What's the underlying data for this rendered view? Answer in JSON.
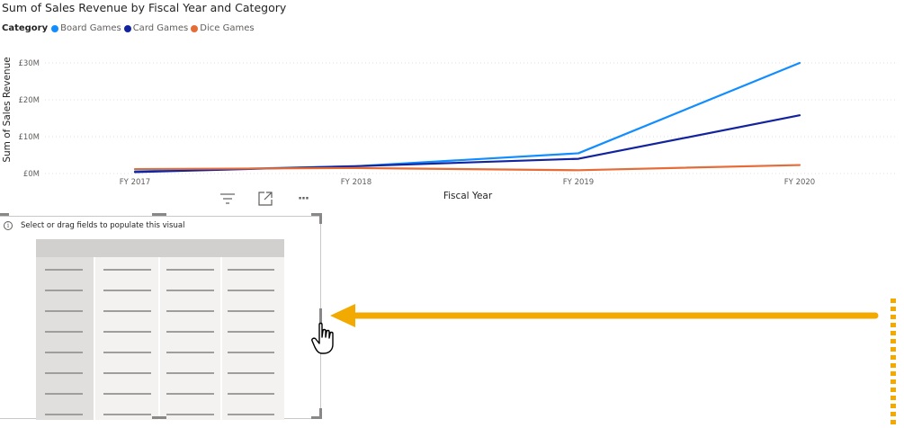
{
  "chart_data": {
    "type": "line",
    "title": "Sum of Sales Revenue by Fiscal Year and Category",
    "legend_title": "Category",
    "legend_position": "top-left",
    "xlabel": "Fiscal Year",
    "ylabel": "Sum of Sales Revenue",
    "categories": [
      "FY 2017",
      "FY 2018",
      "FY 2019",
      "FY 2020"
    ],
    "y_ticks": [
      0,
      10,
      20,
      30
    ],
    "y_tick_labels": [
      "£0M",
      "£10M",
      "£20M",
      "£30M"
    ],
    "ylim": [
      0,
      30
    ],
    "y_unit": "£M",
    "grid": "horizontal dotted",
    "series": [
      {
        "name": "Board Games",
        "color": "#118DFF",
        "values": [
          0.6,
          2.0,
          5.5,
          30.0
        ]
      },
      {
        "name": "Card Games",
        "color": "#12239E",
        "values": [
          0.4,
          2.0,
          4.0,
          15.8
        ]
      },
      {
        "name": "Dice Games",
        "color": "#E66C37",
        "values": [
          1.2,
          1.5,
          0.9,
          2.3
        ]
      }
    ]
  },
  "visual_header": {
    "icons": [
      "filter-icon",
      "focus-mode-icon",
      "more-options-icon"
    ],
    "more_label": "···"
  },
  "table_visual": {
    "info_text": "Select or drag fields to populate this visual",
    "info_icon": "i"
  },
  "annotation": {
    "arrow_color": "#F2A900",
    "cursor": "hand-pointer-icon"
  }
}
